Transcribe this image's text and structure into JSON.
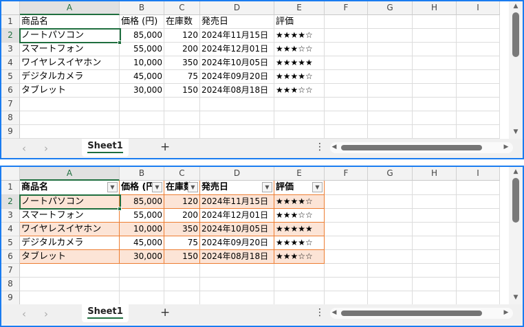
{
  "columns": [
    "A",
    "B",
    "C",
    "D",
    "E",
    "F",
    "G",
    "H",
    "I"
  ],
  "row_numbers": [
    "1",
    "2",
    "3",
    "4",
    "5",
    "6",
    "7",
    "8",
    "9"
  ],
  "headers": [
    "商品名",
    "価格 (円)",
    "在庫数",
    "発売日",
    "評価"
  ],
  "rows": [
    [
      "ノートパソコン",
      "85,000",
      "120",
      "2024年11月15日",
      "★★★★☆"
    ],
    [
      "スマートフォン",
      "55,000",
      "200",
      "2024年12月01日",
      "★★★☆☆"
    ],
    [
      "ワイヤレスイヤホン",
      "10,000",
      "350",
      "2024年10月05日",
      "★★★★★"
    ],
    [
      "デジタルカメラ",
      "45,000",
      "75",
      "2024年09月20日",
      "★★★★☆"
    ],
    [
      "タブレット",
      "30,000",
      "150",
      "2024年08月18日",
      "★★★☆☆"
    ]
  ],
  "sheet_tab": "Sheet1",
  "add_sheet": "+",
  "more": "⋮",
  "nav_prev": "‹",
  "nav_next": "›",
  "colors": {
    "accent": "#1e6e3e",
    "table_border": "#ed7d31",
    "band": "#fce4d6",
    "frame": "#1a7cf0"
  }
}
